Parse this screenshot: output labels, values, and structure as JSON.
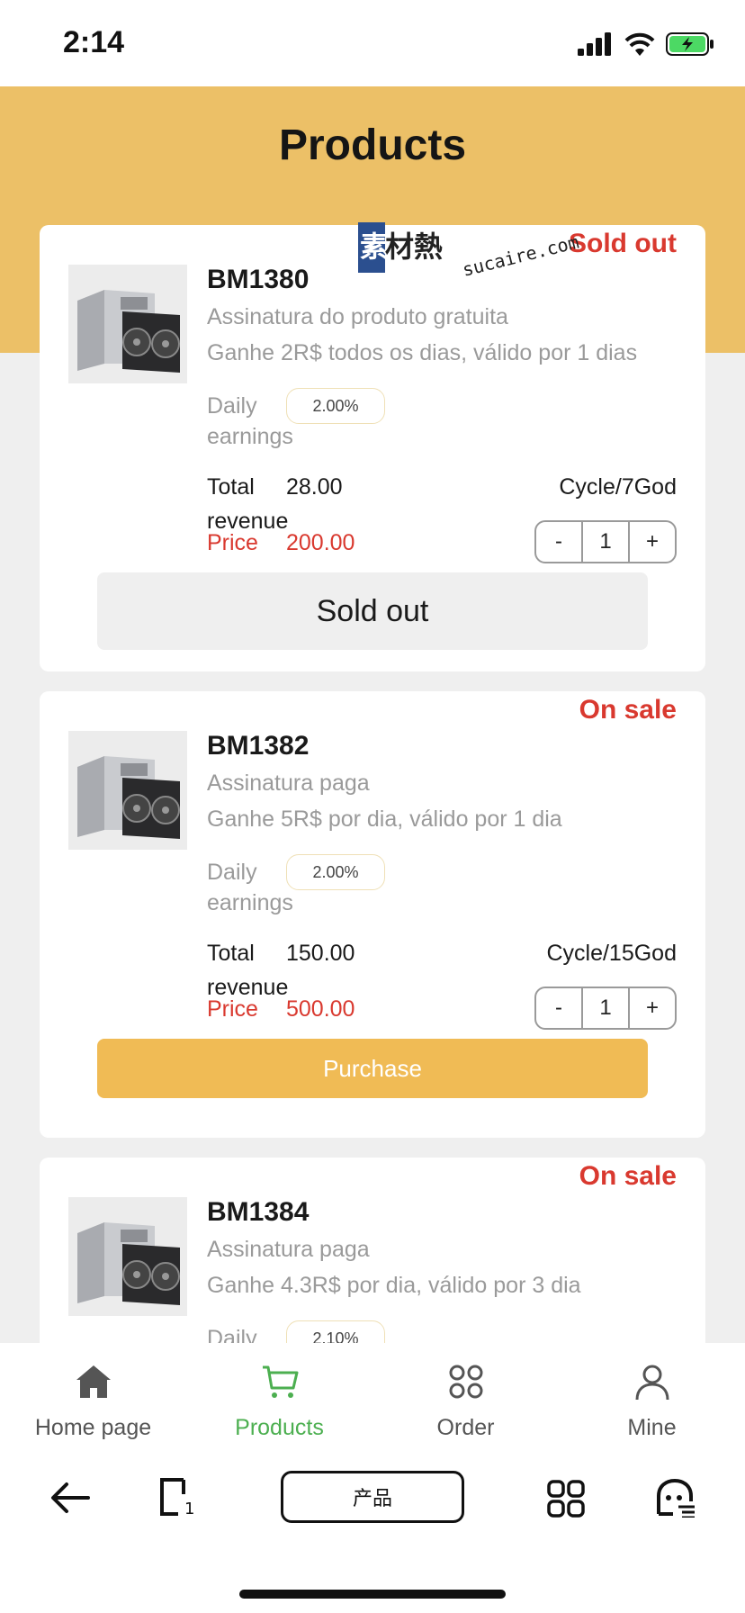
{
  "status_bar": {
    "time": "2:14"
  },
  "header": {
    "title": "Products"
  },
  "watermark": {
    "text_cn": "素材熱",
    "text_en": "sucaire.com"
  },
  "products": [
    {
      "name": "BM1380",
      "status": "Sold out",
      "subtitle": "Assinatura do produto gratuita",
      "description": "Ganhe 2R$ todos os dias, válido por 1 dias",
      "daily_label": "Daily earnings",
      "daily_rate": "2.00%",
      "total_label": "Total revenue",
      "total_value": "28.00",
      "cycle": "Cycle/7God",
      "price_label": "Price",
      "price_value": "200.00",
      "quantity": "1",
      "minus": "-",
      "plus": "+",
      "action": "Sold out"
    },
    {
      "name": "BM1382",
      "status": "On sale",
      "subtitle": "Assinatura paga",
      "description": "Ganhe 5R$ por dia, válido por 1 dia",
      "daily_label": "Daily earnings",
      "daily_rate": "2.00%",
      "total_label": "Total revenue",
      "total_value": "150.00",
      "cycle": "Cycle/15God",
      "price_label": "Price",
      "price_value": "500.00",
      "quantity": "1",
      "minus": "-",
      "plus": "+",
      "action": "Purchase"
    },
    {
      "name": "BM1384",
      "status": "On sale",
      "subtitle": "Assinatura paga",
      "description": "Ganhe 4.3R$ por dia, válido por 3 dia",
      "daily_label": "Daily",
      "daily_rate": "2.10%"
    }
  ],
  "tabbar": {
    "items": [
      {
        "label": "Home page",
        "icon": "home-icon"
      },
      {
        "label": "Products",
        "icon": "cart-icon",
        "active": true
      },
      {
        "label": "Order",
        "icon": "order-icon"
      },
      {
        "label": "Mine",
        "icon": "user-icon"
      }
    ]
  },
  "system_nav": {
    "center_label": "产品"
  },
  "colors": {
    "accent": "#ecc067",
    "button": "#f0bb55",
    "red": "#d9392f",
    "active_tab": "#4caf50"
  }
}
